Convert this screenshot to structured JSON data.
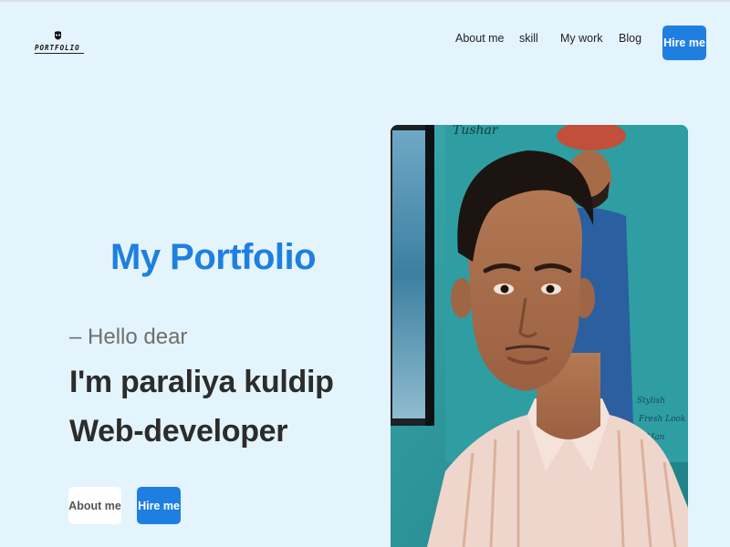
{
  "header": {
    "logo_text": "PORTFOLIO",
    "nav": [
      "About me",
      "skill",
      "My work",
      "Blog"
    ],
    "hire_label": "Hire me"
  },
  "hero": {
    "title": "My Portfolio",
    "greeting": "– Hello dear",
    "name": "I'm paraliya kuldip",
    "role": "Web-developer",
    "about_button": "About me",
    "hire_button": "Hire me"
  },
  "photo": {
    "poster_text": "Tushar",
    "signature_lines": [
      "Stylish",
      "Fresh Look",
      "Man"
    ]
  },
  "colors": {
    "background": "#e4f4fc",
    "accent": "#1f7fe0",
    "text_dark": "#2c2c2c",
    "text_muted": "#6f6f6f"
  }
}
